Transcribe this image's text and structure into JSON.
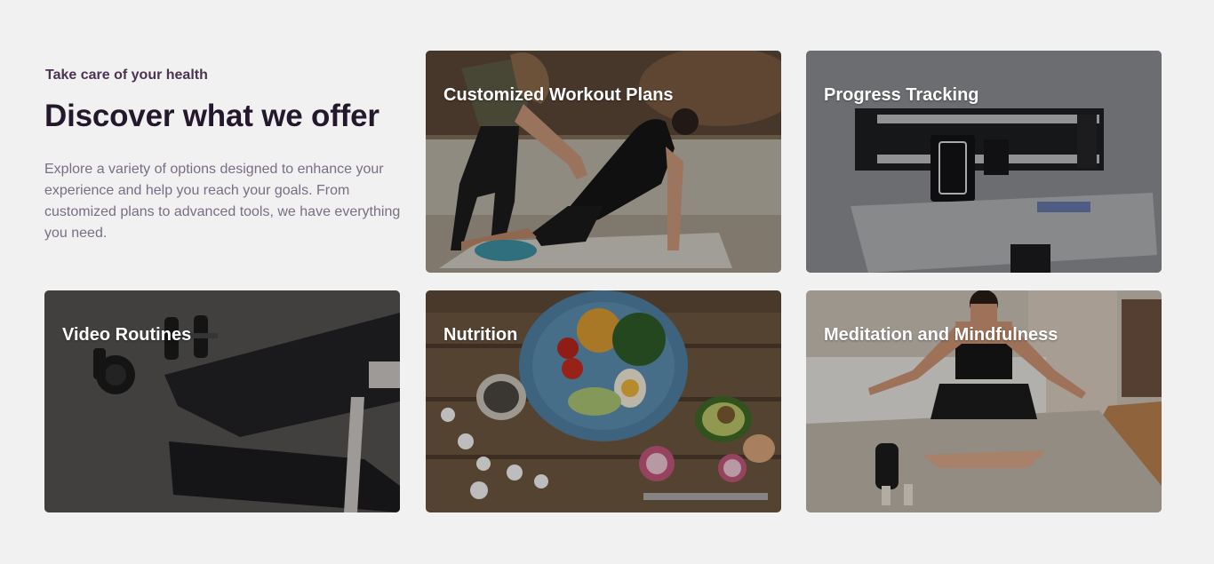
{
  "intro": {
    "eyebrow": "Take care of your health",
    "headline": "Discover what we offer",
    "description": "Explore a variety of options designed to enhance your experience and help you reach your goals. From customized plans to advanced tools, we have everything you need."
  },
  "cards": [
    {
      "title": "Customized Workout Plans"
    },
    {
      "title": "Progress Tracking"
    },
    {
      "title": "Video Routines"
    },
    {
      "title": "Nutrition"
    },
    {
      "title": "Meditation and Mindfulness"
    }
  ],
  "colors": {
    "page_background": "#f1f1f1",
    "eyebrow": "#4a3452",
    "headline": "#24182c",
    "body_text": "#7a6d86",
    "card_title": "#ffffff"
  }
}
